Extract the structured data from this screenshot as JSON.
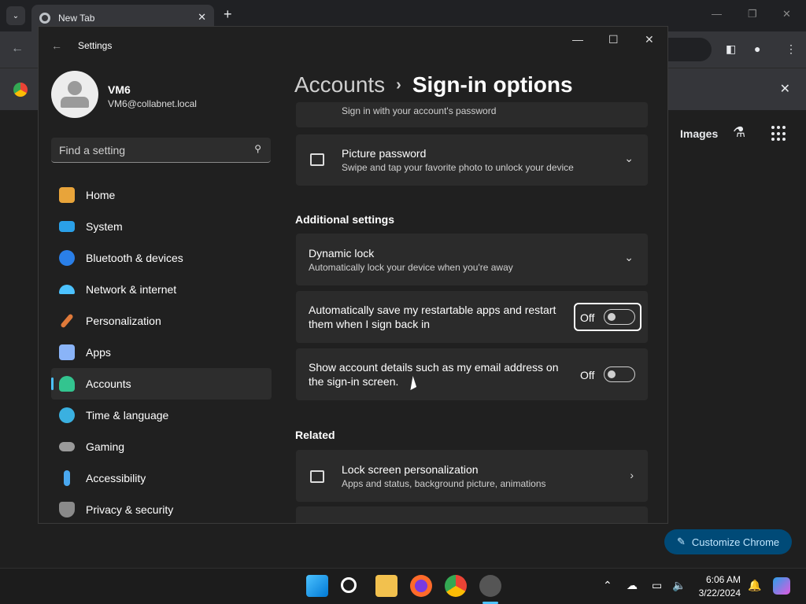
{
  "browser": {
    "tab_title": "New Tab",
    "new_tab_symbol": "+",
    "tab_close_symbol": "✕",
    "images_link": "Images",
    "customize_button": "Customize Chrome"
  },
  "settings": {
    "window_title": "Settings",
    "profile": {
      "name": "VM6",
      "email": "VM6@collabnet.local"
    },
    "search_placeholder": "Find a setting",
    "nav": [
      {
        "label": "Home",
        "icon": "home-icon",
        "color": "#e8a43a"
      },
      {
        "label": "System",
        "icon": "system-icon",
        "color": "#2aa0e8"
      },
      {
        "label": "Bluetooth & devices",
        "icon": "bluetooth-icon",
        "color": "#2a7fe8"
      },
      {
        "label": "Network & internet",
        "icon": "wifi-icon",
        "color": "#4cc2ff"
      },
      {
        "label": "Personalization",
        "icon": "brush-icon",
        "color": "#e07a3a"
      },
      {
        "label": "Apps",
        "icon": "apps-icon",
        "color": "#8ab4f8"
      },
      {
        "label": "Accounts",
        "icon": "accounts-icon",
        "color": "#33c48f"
      },
      {
        "label": "Time & language",
        "icon": "globe-icon",
        "color": "#3ab0e0"
      },
      {
        "label": "Gaming",
        "icon": "gamepad-icon",
        "color": "#9a9a9a"
      },
      {
        "label": "Accessibility",
        "icon": "accessibility-icon",
        "color": "#4aa8f0"
      },
      {
        "label": "Privacy & security",
        "icon": "shield-icon",
        "color": "#8a8a8a"
      }
    ],
    "selected_nav": "Accounts",
    "breadcrumb": {
      "parent": "Accounts",
      "separator": "›",
      "current": "Sign-in options"
    },
    "partial_card_subtitle": "Sign in with your account's password",
    "picture_password": {
      "title": "Picture password",
      "subtitle": "Swipe and tap your favorite photo to unlock your device"
    },
    "additional_heading": "Additional settings",
    "dynamic_lock": {
      "title": "Dynamic lock",
      "subtitle": "Automatically lock your device when you're away"
    },
    "restart_apps": {
      "line1": "Automatically save my restartable apps and restart",
      "line2": "them when I sign back in",
      "state": "Off"
    },
    "account_details": {
      "line1": "Show account details such as my email address on",
      "line2": "the sign-in screen.",
      "state": "Off"
    },
    "related_heading": "Related",
    "lock_screen": {
      "title": "Lock screen personalization",
      "subtitle": "Apps and status, background picture, animations"
    }
  },
  "taskbar": {
    "time": "6:06 AM",
    "date": "3/22/2024",
    "apps": [
      "start-icon",
      "search-icon",
      "file-explorer-icon",
      "firefox-icon",
      "chrome-icon",
      "settings-icon"
    ]
  }
}
